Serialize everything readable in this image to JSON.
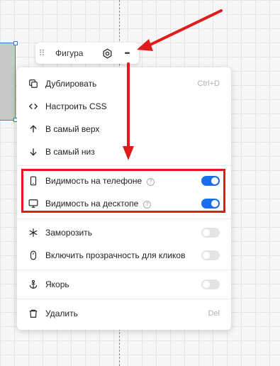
{
  "toolbar": {
    "shape_label": "Фигура",
    "drag_handle": "grip-icon",
    "settings_icon": "gear-icon",
    "more_icon": "more-dots-icon",
    "more_glyph": "•••"
  },
  "menu": {
    "items": [
      {
        "label": "Дублировать",
        "shortcut": "Ctrl+D",
        "icon": "duplicate-icon"
      },
      {
        "label": "Настроить CSS",
        "icon": "code-icon"
      },
      {
        "label": "В самый верх",
        "icon": "arrow-up-icon"
      },
      {
        "label": "В самый низ",
        "icon": "arrow-down-icon"
      },
      {
        "label": "Видимость на телефоне",
        "icon": "phone-icon",
        "toggle": true
      },
      {
        "label": "Видимость на десктопе",
        "icon": "desktop-icon",
        "toggle": true
      },
      {
        "label": "Заморозить",
        "icon": "snowflake-icon",
        "toggle": false
      },
      {
        "label": "Включить прозрачность для кликов",
        "icon": "mouse-icon",
        "toggle": false
      },
      {
        "label": "Якорь",
        "icon": "anchor-icon",
        "toggle": false
      },
      {
        "label": "Удалить",
        "shortcut": "Del",
        "icon": "trash-icon"
      }
    ],
    "help_glyph": "?"
  },
  "colors": {
    "toggle_on": "#1a6ee8",
    "toggle_off": "#e4e4e4",
    "highlight": "#e01b1b",
    "arrow": "#e01b1b",
    "selection": "#3a7bd5"
  }
}
